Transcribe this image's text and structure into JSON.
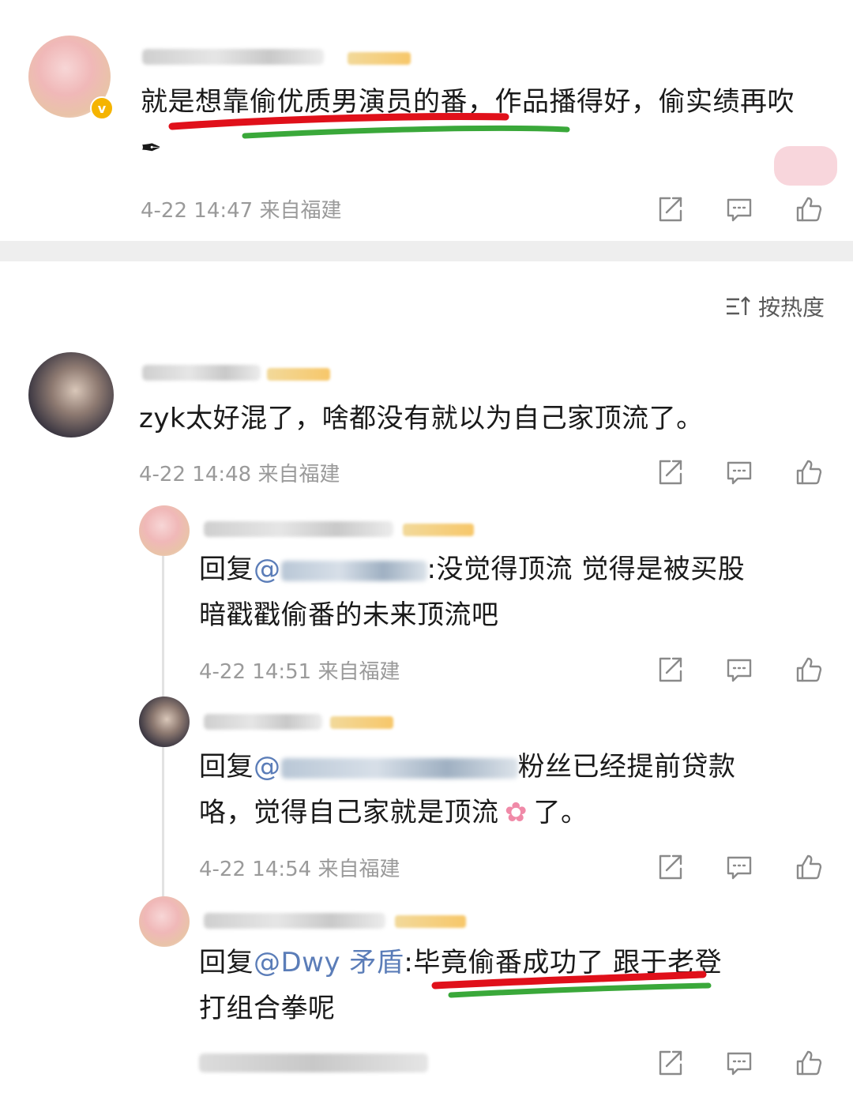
{
  "sort": {
    "label": "按热度"
  },
  "comments": [
    {
      "text": "就是想靠偷优质男演员的番，作品播得好，偷实绩再吹",
      "time": "4-22 14:47",
      "location": "来自福建"
    },
    {
      "text": "zyk太好混了，啥都没有就以为自己家顶流了。",
      "time": "4-22 14:48",
      "location": "来自福建"
    }
  ],
  "replies": [
    {
      "prefix": "回复",
      "mention": "@",
      "text_line1": ":没觉得顶流 觉得是被买股",
      "text_line2": "暗戳戳偷番的未来顶流吧",
      "time": "4-22 14:51",
      "location": "来自福建"
    },
    {
      "prefix": "回复",
      "mention": "@",
      "text_line1": "粉丝已经提前贷款",
      "text_line2_a": "咯，觉得自己家就是顶流",
      "text_line2_b": "了。",
      "time": "4-22 14:54",
      "location": "来自福建"
    },
    {
      "prefix": "回复",
      "mention": "@Dwy 矛盾",
      "text_line1": ":毕竟偷番成功了 跟于老登",
      "text_line2": "打组合拳呢"
    }
  ],
  "icons": {
    "share": "share-icon",
    "comment": "comment-icon",
    "like": "thumbs-up-icon",
    "sort": "sort-icon",
    "flower": "flower-emoji-icon",
    "pen": "pen-emoji-icon"
  },
  "colors": {
    "mention": "#5b7db8",
    "meta": "#9a9a9a",
    "red_mark": "#e0101a",
    "green_mark": "#3aa83a"
  }
}
